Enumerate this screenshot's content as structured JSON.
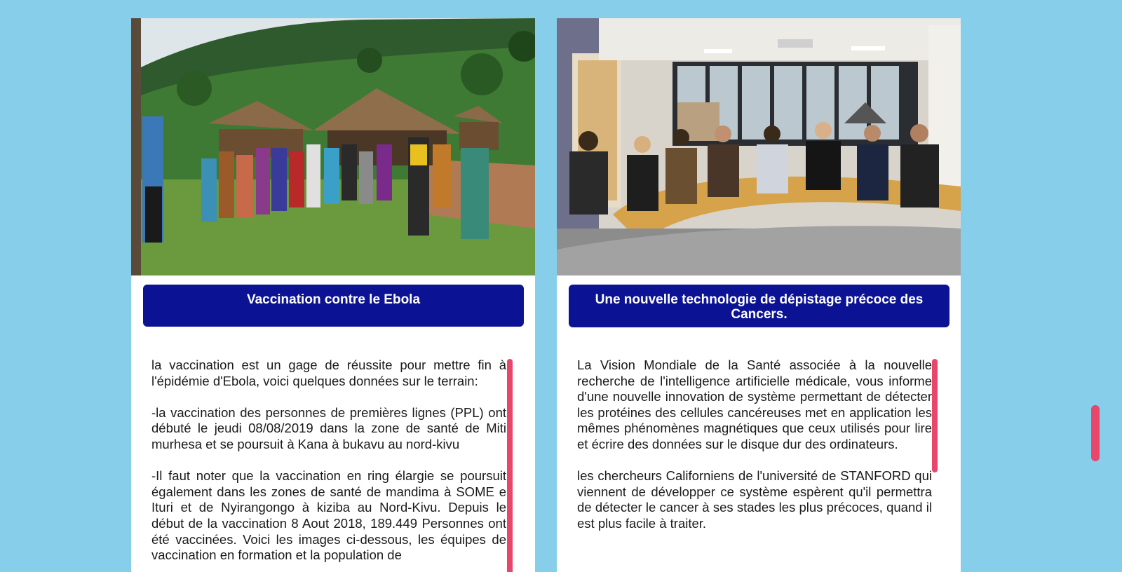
{
  "cards": [
    {
      "title": "Vaccination contre le Ebola",
      "paragraphs": [
        "la vaccination est un gage de réussite pour mettre fin à l'épidémie d'Ebola, voici quelques données sur le terrain:",
        "-la vaccination des personnes de premières lignes (PPL) ont débuté le jeudi 08/08/2019 dans la zone de santé de Miti murhesa et se poursuit à Kana à bukavu au nord-kivu",
        "-Il faut noter que la vaccination en ring élargie se poursuit également dans les zones de santé de mandima à SOME e Ituri et de Nyirangongo à kiziba au Nord-Kivu. Depuis le début de la vaccination 8 Aout 2018, 189.449 Personnes ont été vaccinées. Voici les images ci-dessous, les équipes de vaccination en formation et la population de"
      ]
    },
    {
      "title": "Une nouvelle technologie de dépistage précoce des Cancers.",
      "paragraphs": [
        "La Vision Mondiale de la Santé associée à la nouvelle recherche de l'intelligence artificielle médicale, vous informe d'une nouvelle innovation de système permettant de détecter les protéines des cellules cancéreuses met en application les mêmes phénomènes magnétiques que ceux utilisés pour lire et écrire des données sur le disque dur des ordinateurs.",
        "les chercheurs Californiens de l'université de STANFORD qui viennent de développer ce système espèrent qu'il permettra de détecter le cancer à ses stades les plus précoces, quand il est plus facile à traiter."
      ]
    }
  ],
  "colors": {
    "page_bg": "#87ceeb",
    "title_bg": "#0b1394",
    "scroll_thumb": "#e8466a"
  }
}
